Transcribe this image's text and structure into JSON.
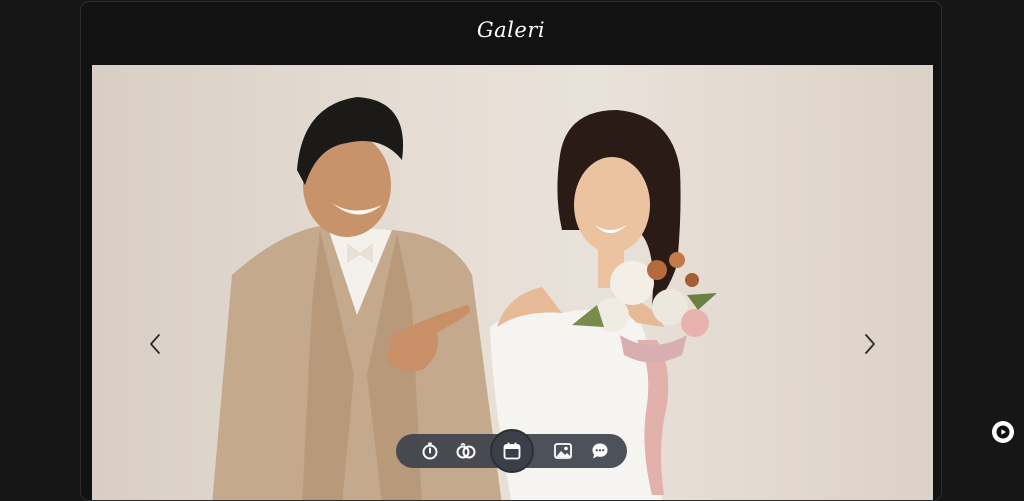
{
  "header": {
    "title": "Galeri"
  },
  "gallery": {
    "current_image": "wedding-couple-photo",
    "prev_icon": "chevron-left-icon",
    "next_icon": "chevron-right-icon"
  },
  "dock": {
    "items": [
      {
        "icon": "stopwatch-icon"
      },
      {
        "icon": "rings-icon"
      },
      {
        "icon": "calendar-icon",
        "active": true
      },
      {
        "icon": "image-icon"
      },
      {
        "icon": "chat-bubble-icon"
      }
    ]
  },
  "music": {
    "icon": "play-disc-icon"
  },
  "colors": {
    "page_background": "#161616",
    "card_background": "#121212",
    "dock_background": "#3e424c",
    "title_color": "#ffffff"
  }
}
